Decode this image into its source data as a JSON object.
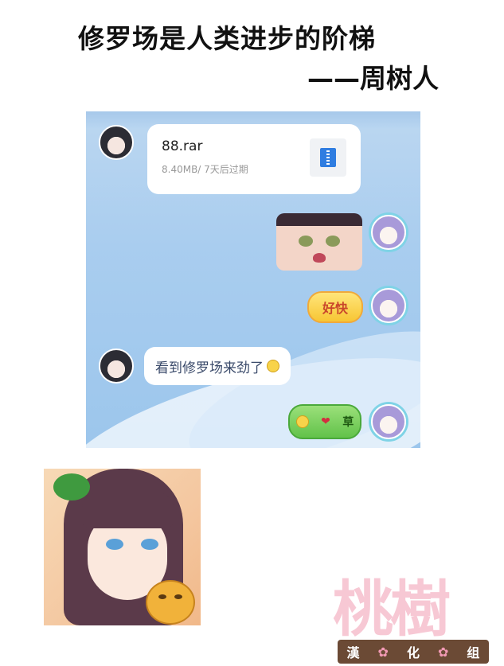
{
  "header": {
    "quote": "修罗场是人类进步的阶梯",
    "author": "——周树人"
  },
  "chat": {
    "file_message": {
      "file_name": "88.rar",
      "file_meta": "8.40MB/ 7天后过期",
      "icon": "zip-file-icon"
    },
    "sticker_label": "好快",
    "text_message": "看到修罗场来劲了",
    "reaction_text": "草"
  },
  "watermark": {
    "title": "桃樹",
    "subtitle": [
      "漢",
      "化",
      "组"
    ]
  },
  "colors": {
    "chat_bg": "#a9cdef",
    "bubble_bg": "#ffffff",
    "logo_pink": "#f7c8d4",
    "logo_brown": "#6b4a35"
  }
}
